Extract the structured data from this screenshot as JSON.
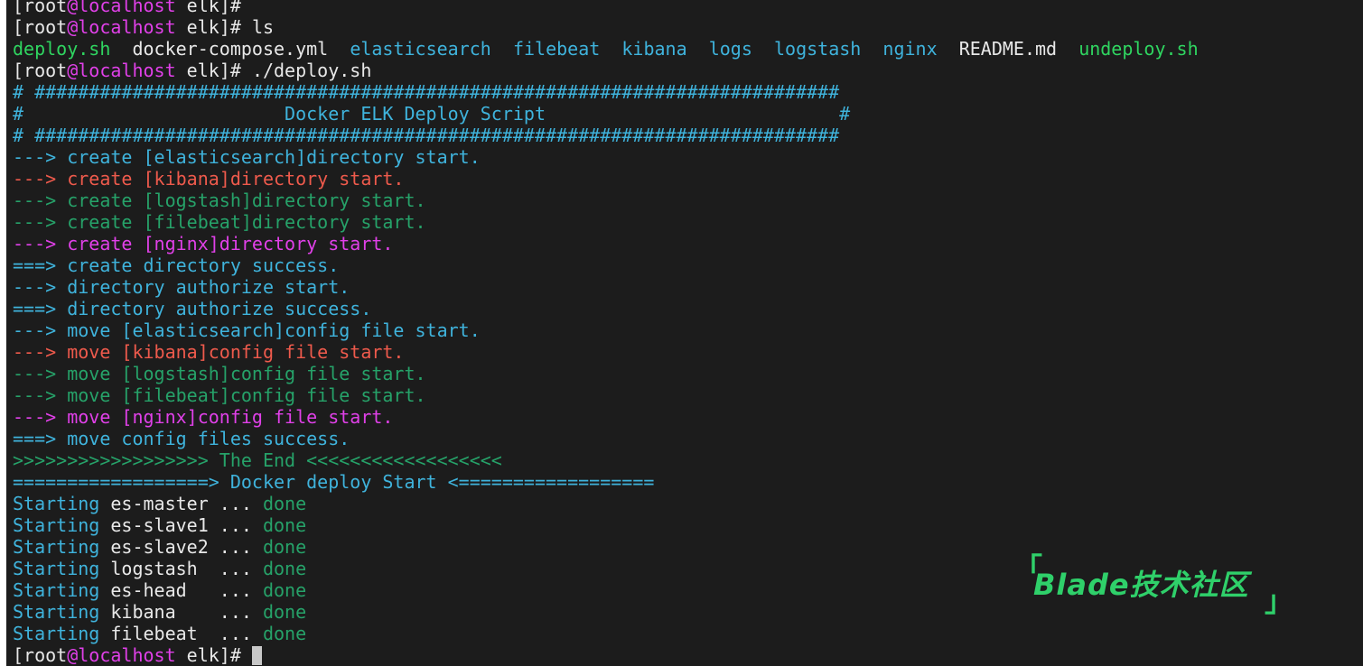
{
  "terminal": {
    "prompt": {
      "open": "[",
      "user": "root",
      "at": "@",
      "host": "localhost",
      "dir": " elk]# "
    },
    "ls_cmd": "ls",
    "deploy_cmd": "./deploy.sh",
    "ls_files": [
      {
        "name": "deploy.sh",
        "sep": "  "
      },
      {
        "name": "docker-compose.yml",
        "sep": "  "
      },
      {
        "name": "elasticsearch",
        "sep": "  "
      },
      {
        "name": "filebeat",
        "sep": "  "
      },
      {
        "name": "kibana",
        "sep": "  "
      },
      {
        "name": "logs",
        "sep": "  "
      },
      {
        "name": "logstash",
        "sep": "  "
      },
      {
        "name": "nginx",
        "sep": "  "
      },
      {
        "name": "README.md",
        "sep": "  "
      },
      {
        "name": "undeploy.sh",
        "sep": ""
      }
    ],
    "banner_border": "# ##########################################################################",
    "banner_title": "#                        Docker ELK Deploy Script                           #",
    "steps": [
      "---> create [elasticsearch]directory start.",
      "---> create [kibana]directory start.",
      "---> create [logstash]directory start.",
      "---> create [filebeat]directory start.",
      "---> create [nginx]directory start.",
      "===> create directory success.",
      "---> directory authorize start.",
      "===> directory authorize success.",
      "---> move [elasticsearch]config file start.",
      "---> move [kibana]config file start.",
      "---> move [logstash]config file start.",
      "---> move [filebeat]config file start.",
      "---> move [nginx]config file start.",
      "===> move config files success."
    ],
    "the_end": ">>>>>>>>>>>>>>>>>> The End <<<<<<<<<<<<<<<<<<",
    "docker_start": "==================> Docker deploy Start <==================",
    "starting_word": "Starting ",
    "services": [
      {
        "name": "es-master",
        "dots": " ... ",
        "status": "done"
      },
      {
        "name": "es-slave1",
        "dots": " ... ",
        "status": "done"
      },
      {
        "name": "es-slave2",
        "dots": " ... ",
        "status": "done"
      },
      {
        "name": "logstash ",
        "dots": " ... ",
        "status": "done"
      },
      {
        "name": "es-head  ",
        "dots": " ... ",
        "status": "done"
      },
      {
        "name": "kibana   ",
        "dots": " ... ",
        "status": "done"
      },
      {
        "name": "filebeat ",
        "dots": " ... ",
        "status": "done"
      }
    ]
  },
  "watermark": {
    "open": "「",
    "text": "Blade技术社区",
    "close": "」"
  },
  "colors": {
    "background": "#1c1c1c",
    "text": "#e8e8e8",
    "magenta": "#e040e8",
    "blue": "#3fb3dc",
    "red": "#ee5a4c",
    "green": "#26a269",
    "light_green": "#2fd560"
  }
}
